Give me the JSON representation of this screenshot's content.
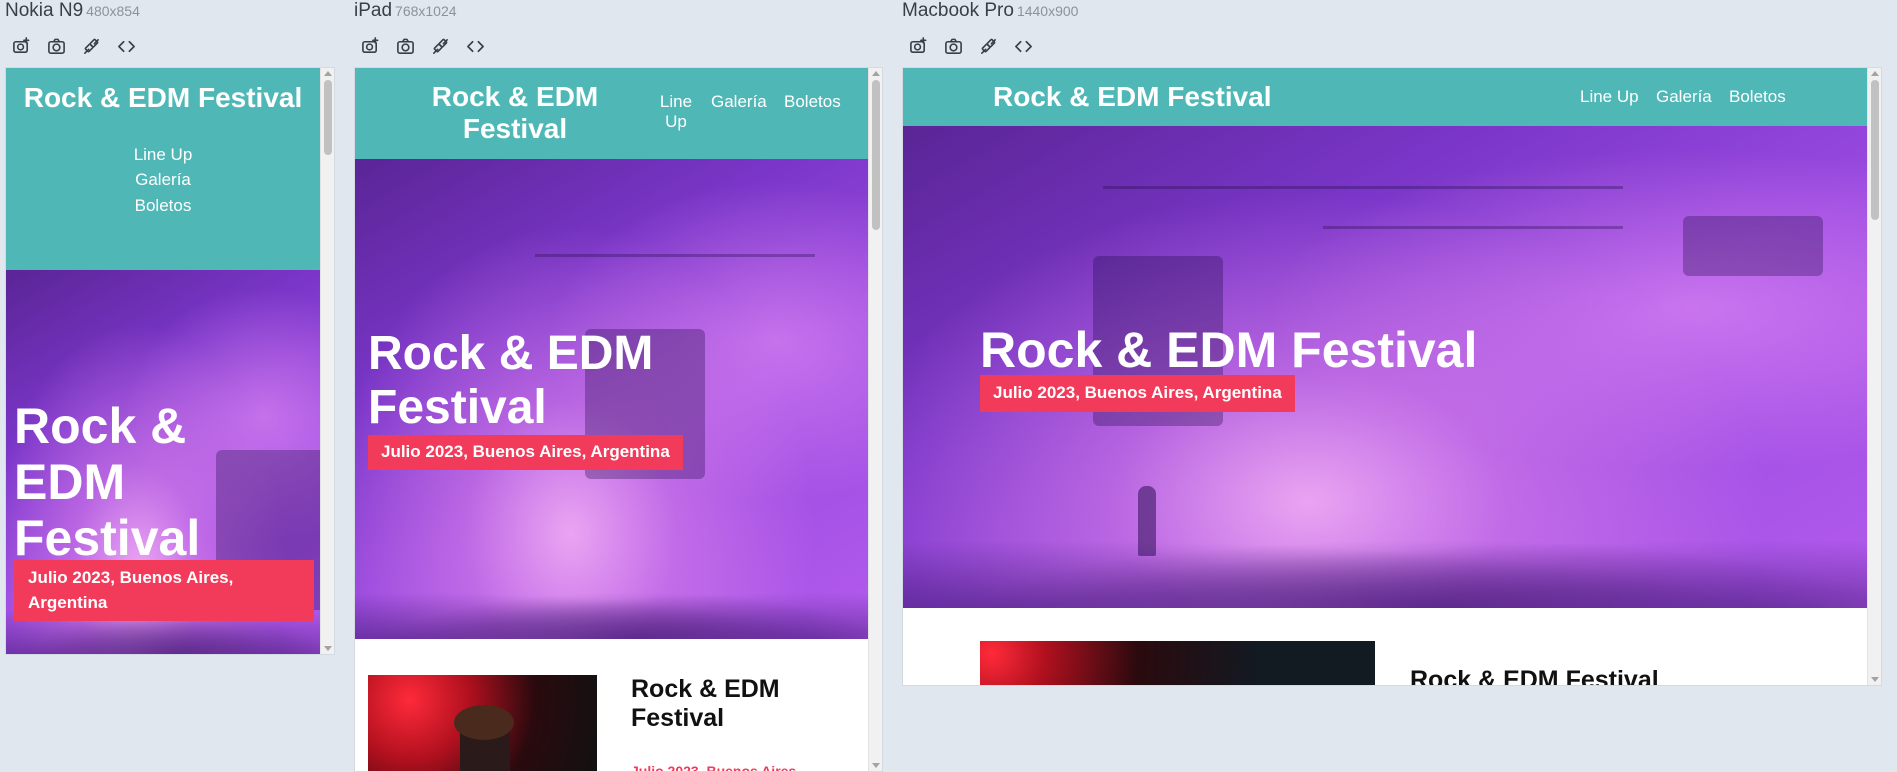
{
  "toolbar_icons": [
    "camera-plus-icon",
    "camera-icon",
    "sync-scroll-icon",
    "code-icon"
  ],
  "site": {
    "brand": "Rock & EDM Festival",
    "nav": [
      "Line Up",
      "Galería",
      "Boletos"
    ],
    "hero_title": "Rock & EDM Festival",
    "hero_date": "Julio 2023, Buenos Aires, Argentina",
    "about_title": "Rock & EDM Festival",
    "about_date": "Julio 2023, Buenos Aires"
  },
  "colors": {
    "header": "#4fb8b7",
    "accent": "#f23a5a",
    "page_bg": "#e1e7ef"
  },
  "devices": [
    {
      "name": "Nokia N9",
      "size": "480x854"
    },
    {
      "name": "iPad",
      "size": "768x1024"
    },
    {
      "name": "Macbook Pro",
      "size": "1440x900"
    }
  ]
}
